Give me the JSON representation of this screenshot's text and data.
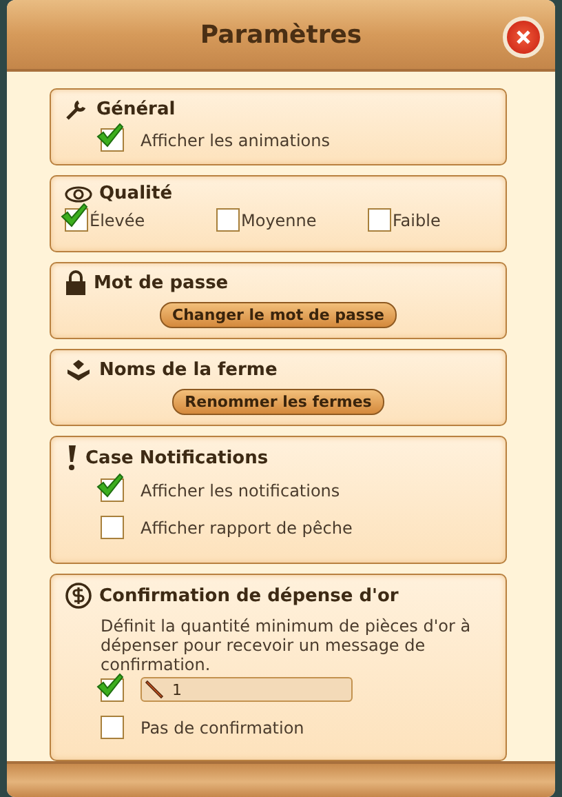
{
  "window": {
    "title": "Paramètres"
  },
  "sections": [
    {
      "kind": "options",
      "title": "Général",
      "options": [
        {
          "label": "Afficher les animations",
          "checked": true
        }
      ]
    },
    {
      "kind": "inline-options",
      "title": "Qualité",
      "options": [
        {
          "label": "Élevée",
          "checked": true
        },
        {
          "label": "Moyenne",
          "checked": false
        },
        {
          "label": "Faible",
          "checked": false
        }
      ]
    },
    {
      "kind": "button",
      "title": "Mot de passe",
      "button": "Changer le mot de passe"
    },
    {
      "kind": "button",
      "title": "Noms de la ferme",
      "button": "Renommer les fermes"
    },
    {
      "kind": "options",
      "title": "Case Notifications",
      "options": [
        {
          "label": "Afficher les notifications",
          "checked": true
        },
        {
          "label": "Afficher rapport de pêche",
          "checked": false
        }
      ]
    },
    {
      "kind": "amount",
      "title": "Confirmation de dépense d'or",
      "description": "Définit la quantité minimum de pièces d'or à dépenser pour recevoir un message de confirmation.",
      "amount": {
        "value": "1",
        "checked": true
      },
      "options": [
        {
          "label": "Pas de confirmation",
          "checked": false
        }
      ]
    }
  ]
}
